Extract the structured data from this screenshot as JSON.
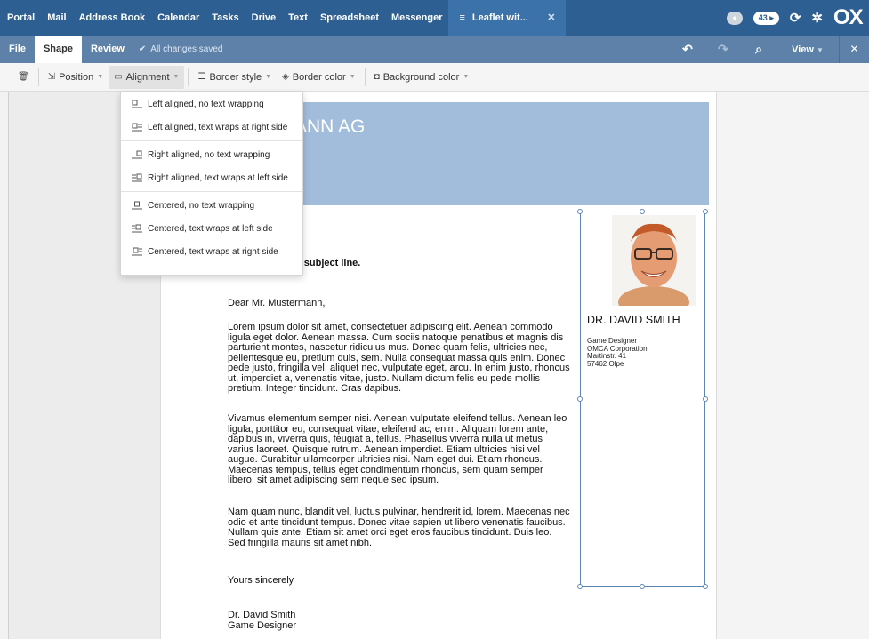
{
  "topnav": {
    "items": [
      "Portal",
      "Mail",
      "Address Book",
      "Calendar",
      "Tasks",
      "Drive",
      "Text",
      "Spreadsheet",
      "Messenger"
    ],
    "active_tab": "Leaflet wit...",
    "badge_count": "43",
    "logo": "OX"
  },
  "secbar": {
    "tabs": [
      "File",
      "Shape",
      "Review"
    ],
    "active_tab": "Shape",
    "status": "All changes saved",
    "view_label": "View"
  },
  "toolbar": {
    "position_label": "Position",
    "alignment_label": "Alignment",
    "border_style_label": "Border style",
    "border_color_label": "Border color",
    "background_color_label": "Background color"
  },
  "dropdown": {
    "items": [
      "Left aligned, no text wrapping",
      "Left aligned, text wraps at right side",
      "Right aligned, no text wrapping",
      "Right aligned, text wraps at left side",
      "Centered, no text wrapping",
      "Centered, text wraps at left side",
      "Centered, text wraps at right side"
    ]
  },
  "document": {
    "company_partial": "ANN AG",
    "subject_partial": "our subject line.",
    "salutation": "Dear Mr. Mustermann,",
    "paragraphs": [
      "Lorem ipsum dolor sit amet, consectetuer adipiscing elit. Aenean commodo ligula eget dolor. Aenean massa. Cum sociis natoque penatibus et magnis dis parturient montes, nascetur ridiculus mus. Donec quam felis, ultricies nec, pellentesque eu, pretium quis, sem. Nulla consequat massa quis enim. Donec pede justo, fringilla vel, aliquet nec, vulputate eget, arcu. In enim justo, rhoncus ut, imperdiet a, venenatis vitae, justo. Nullam dictum felis eu pede mollis pretium. Integer tincidunt. Cras dapibus.",
      "Vivamus elementum semper nisi. Aenean vulputate eleifend tellus. Aenean leo ligula, porttitor eu, consequat vitae, eleifend ac, enim. Aliquam lorem ante, dapibus in, viverra quis, feugiat a, tellus. Phasellus viverra nulla ut metus varius laoreet. Quisque rutrum. Aenean imperdiet. Etiam ultricies nisi vel augue. Curabitur ullamcorper ultricies nisi. Nam eget dui. Etiam rhoncus. Maecenas tempus, tellus eget condimentum rhoncus, sem quam semper libero, sit amet adipiscing sem neque sed ipsum.",
      "Nam quam nunc, blandit vel, luctus pulvinar, hendrerit id, lorem. Maecenas nec odio et ante tincidunt tempus. Donec vitae sapien ut libero venenatis faucibus. Nullam quis ante. Etiam sit amet orci eget eros faucibus tincidunt. Duis leo. Sed fringilla mauris sit amet nibh."
    ],
    "closing": "Yours sincerely",
    "signature_name": "Dr. David Smith",
    "signature_title": "Game Designer"
  },
  "shape": {
    "name": "DR. DAVID SMITH",
    "role": "Game Designer",
    "company": "OMCA Corporation",
    "street": "Martinstr. 41",
    "city": "57462 Olpe"
  },
  "colors": {
    "topnav_bg": "#2e5f93",
    "secbar_bg": "#5d81a8",
    "header_band": "#a2bcdc",
    "shape_border": "#5d86b5"
  }
}
